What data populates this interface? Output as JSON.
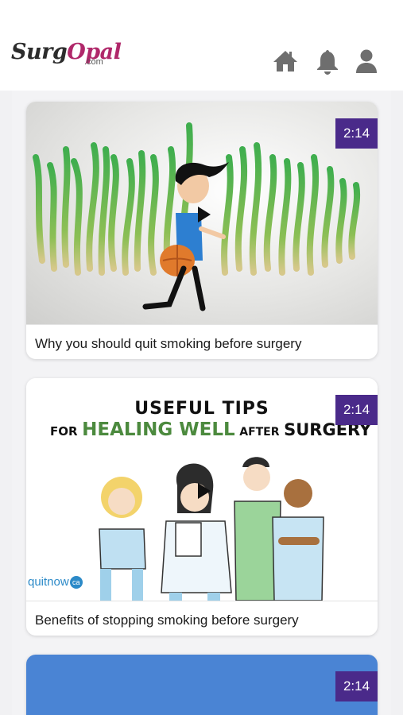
{
  "header": {
    "logo_main": "Surg",
    "logo_accent": "Opal",
    "logo_domain": ".com",
    "icons": [
      "home-icon",
      "bell-icon",
      "user-icon"
    ]
  },
  "videos": [
    {
      "title": "Why you should quit smoking before surgery",
      "duration": "2:14"
    },
    {
      "title": "Benefits of stopping smoking before surgery",
      "duration": "2:14",
      "thumb_heading_1": "USEFUL TIPS",
      "thumb_heading_2a": "FOR",
      "thumb_heading_2b": "HEALING WELL",
      "thumb_heading_2c": "AFTER",
      "thumb_heading_2d": "SURGERY",
      "thumb_brand": "quitnow",
      "thumb_brand_suffix": "ca"
    },
    {
      "title": "",
      "duration": "2:14"
    }
  ],
  "colors": {
    "accent": "#4a2a8a",
    "brand_pink": "#b0286a",
    "icon_gray": "#6e6e6e",
    "third_thumb_blue": "#4a84d4"
  }
}
